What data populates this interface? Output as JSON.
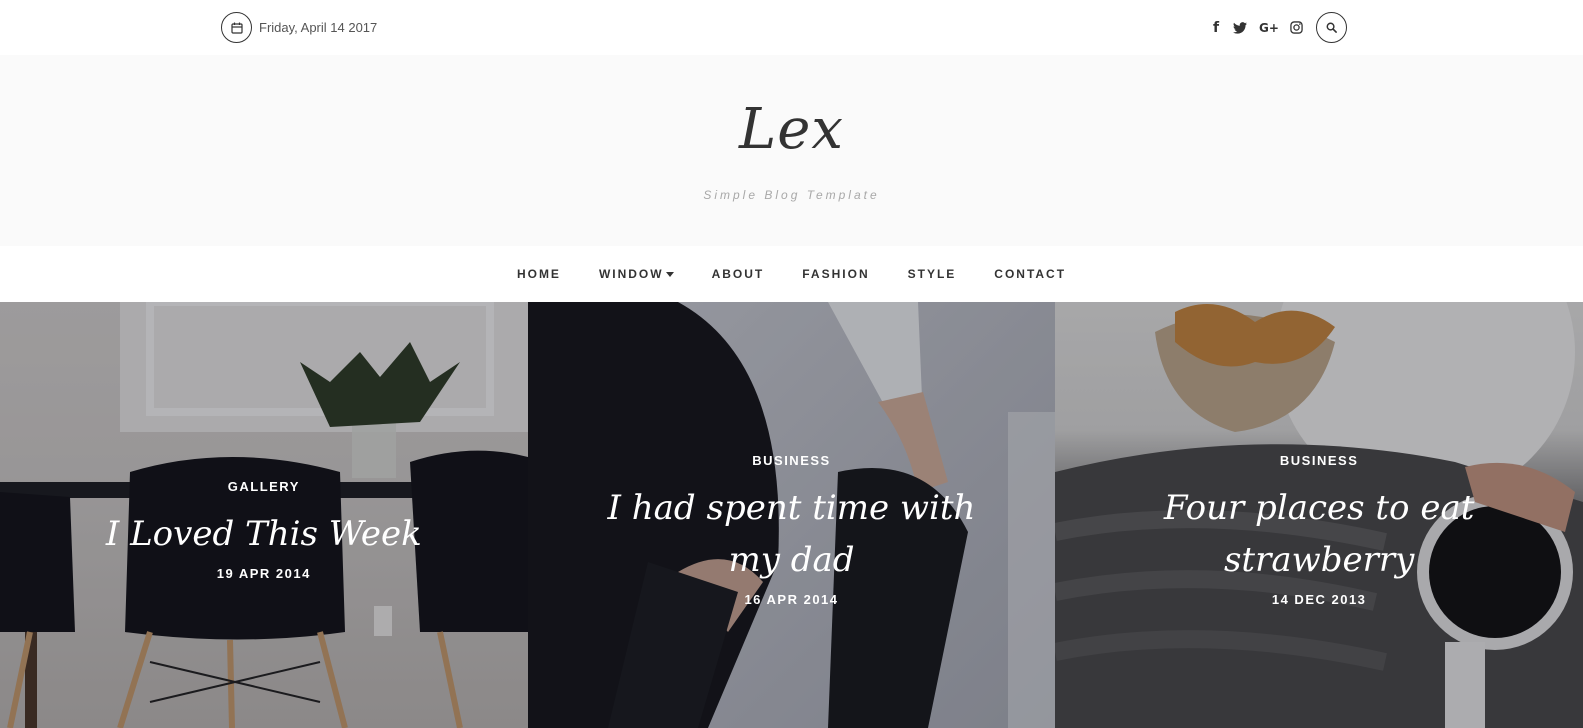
{
  "topbar": {
    "date": "Friday, April 14 2017",
    "social_icons": [
      "facebook-icon",
      "twitter-icon",
      "google-plus-icon",
      "instagram-icon"
    ],
    "search_icon": "search-icon"
  },
  "header": {
    "logo": "Lex",
    "tagline": "Simple Blog Template"
  },
  "nav": {
    "items": [
      {
        "label": "HOME"
      },
      {
        "label": "WINDOW",
        "has_dropdown": true
      },
      {
        "label": "ABOUT"
      },
      {
        "label": "FASHION"
      },
      {
        "label": "STYLE"
      },
      {
        "label": "CONTACT"
      }
    ]
  },
  "posts": [
    {
      "category": "GALLERY",
      "title": "I Loved This Week",
      "date": "19 APR 2014"
    },
    {
      "category": "BUSINESS",
      "title": "I had spent time with my dad",
      "date": "16 APR 2014"
    },
    {
      "category": "BUSINESS",
      "title": "Four places to eat strawberry",
      "date": "14 DEC 2013"
    }
  ],
  "colors": {
    "text_dark": "#333333",
    "tagline": "#a8a8a8",
    "header_bg": "#fafafa",
    "card_text": "#ffffff"
  }
}
